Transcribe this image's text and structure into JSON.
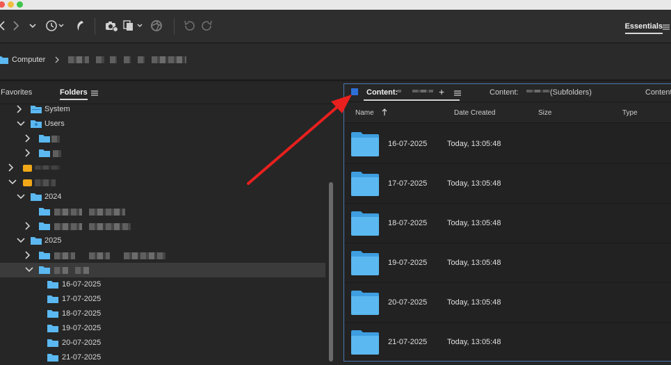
{
  "toolbar": {
    "workspace_label": "Essentials"
  },
  "pathbar": {
    "root_label": "Computer"
  },
  "left_panel": {
    "tabs": [
      {
        "label": "Favorites"
      },
      {
        "label": "Folders"
      }
    ],
    "tree": [
      {
        "label": "System",
        "expanded": false
      },
      {
        "label": "Users",
        "expanded": true
      },
      {
        "label": "2024",
        "expanded": true
      },
      {
        "label": "2025",
        "expanded": true
      },
      {
        "label": "16-07-2025"
      },
      {
        "label": "17-07-2025"
      },
      {
        "label": "18-07-2025"
      },
      {
        "label": "19-07-2025"
      },
      {
        "label": "20-07-2025"
      },
      {
        "label": "21-07-2025"
      }
    ]
  },
  "content_panel": {
    "tabs": [
      {
        "label": "Content:"
      },
      {
        "label": "Content:"
      },
      {
        "label": "(Subfolders)"
      },
      {
        "label": "Content"
      }
    ],
    "columns": {
      "name": "Name",
      "date_created": "Date Created",
      "size": "Size",
      "type": "Type"
    },
    "rows": [
      {
        "name": "16-07-2025",
        "date": "Today, 13:05:48"
      },
      {
        "name": "17-07-2025",
        "date": "Today, 13:05:48"
      },
      {
        "name": "18-07-2025",
        "date": "Today, 13:05:48"
      },
      {
        "name": "19-07-2025",
        "date": "Today, 13:05:48"
      },
      {
        "name": "20-07-2025",
        "date": "Today, 13:05:48"
      },
      {
        "name": "21-07-2025",
        "date": "Today, 13:05:48"
      }
    ]
  },
  "colors": {
    "folder": "#5bb8f0",
    "accent": "#2d6fd6",
    "annotation_arrow": "#e8201e"
  }
}
